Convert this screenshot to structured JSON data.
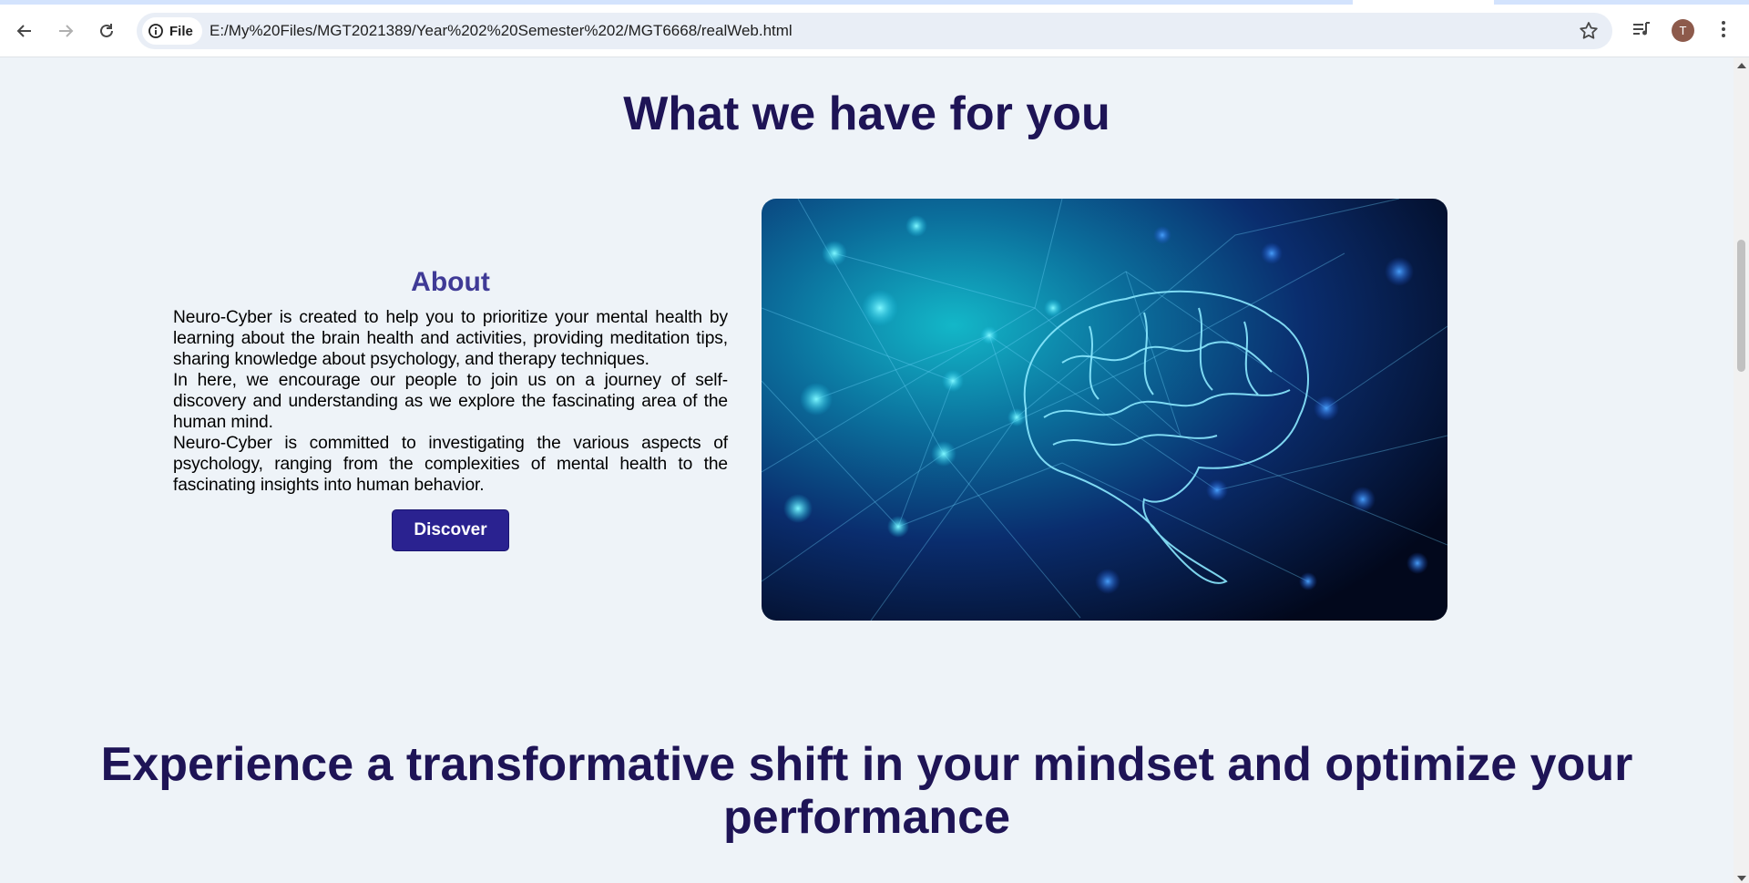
{
  "browser": {
    "site_chip_label": "File",
    "url": "E:/My%20Files/MGT2021389/Year%202%20Semester%202/MGT6668/realWeb.html",
    "avatar_initial": "T"
  },
  "page": {
    "section_title": "What we have for you",
    "about": {
      "title": "About",
      "paragraphs": [
        "Neuro-Cyber is created to help you to prioritize your mental health by learning about the brain health and activities, providing meditation tips, sharing knowledge about psychology, and therapy techniques.",
        "In here, we encourage our people to join us on a journey of self-discovery and understanding as we explore the fascinating area of the human mind.",
        "Neuro-Cyber is committed to investigating the various aspects of psychology, ranging from the complexities of mental health to the fascinating insights into human behavior."
      ],
      "button_label": "Discover"
    },
    "bottom_title": "Experience a transformative shift in your mindset and optimize your performance"
  },
  "colors": {
    "heading": "#1e1456",
    "about_heading": "#3f3a96",
    "button": "#2a2290",
    "page_bg": "#eef3f8"
  }
}
